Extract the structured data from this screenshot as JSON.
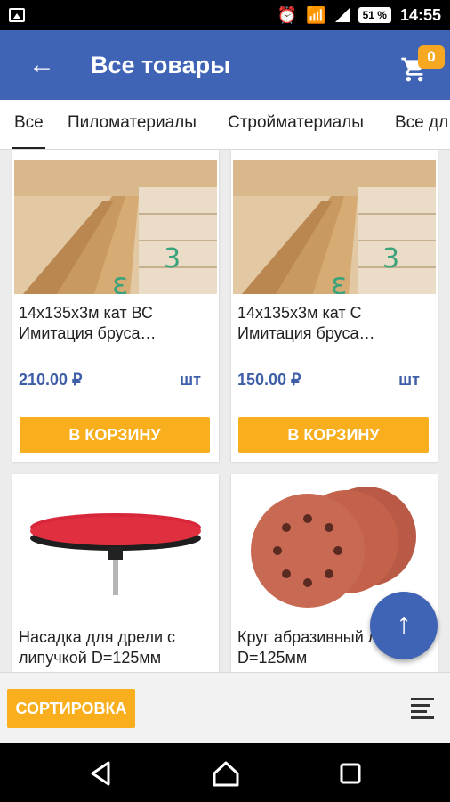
{
  "status_bar": {
    "battery": "51 %",
    "time": "14:55"
  },
  "app_bar": {
    "title": "Все товары",
    "cart_count": "0"
  },
  "tabs": [
    {
      "label": "Все",
      "active": true
    },
    {
      "label": "Пиломатериалы",
      "active": false
    },
    {
      "label": "Стройматериалы",
      "active": false
    },
    {
      "label": "Все дл",
      "active": false
    }
  ],
  "products": [
    {
      "name": "14х135х3м кат ВС Имитация бруса…",
      "price": "210.00 ₽",
      "unit": "шт",
      "button": "В КОРЗИНУ"
    },
    {
      "name": "14х135х3м кат С Имитация бруса…",
      "price": "150.00 ₽",
      "unit": "шт",
      "button": "В КОРЗИНУ"
    },
    {
      "name": "Насадка для дрели с липучкой D=125мм"
    },
    {
      "name": "Круг абразивный липучки D=125мм"
    }
  ],
  "bottom_bar": {
    "sort_label": "СОРТИРОВКА"
  },
  "colors": {
    "primary": "#3f63b5",
    "accent": "#f9ae1e",
    "price": "#3f5ea8"
  }
}
